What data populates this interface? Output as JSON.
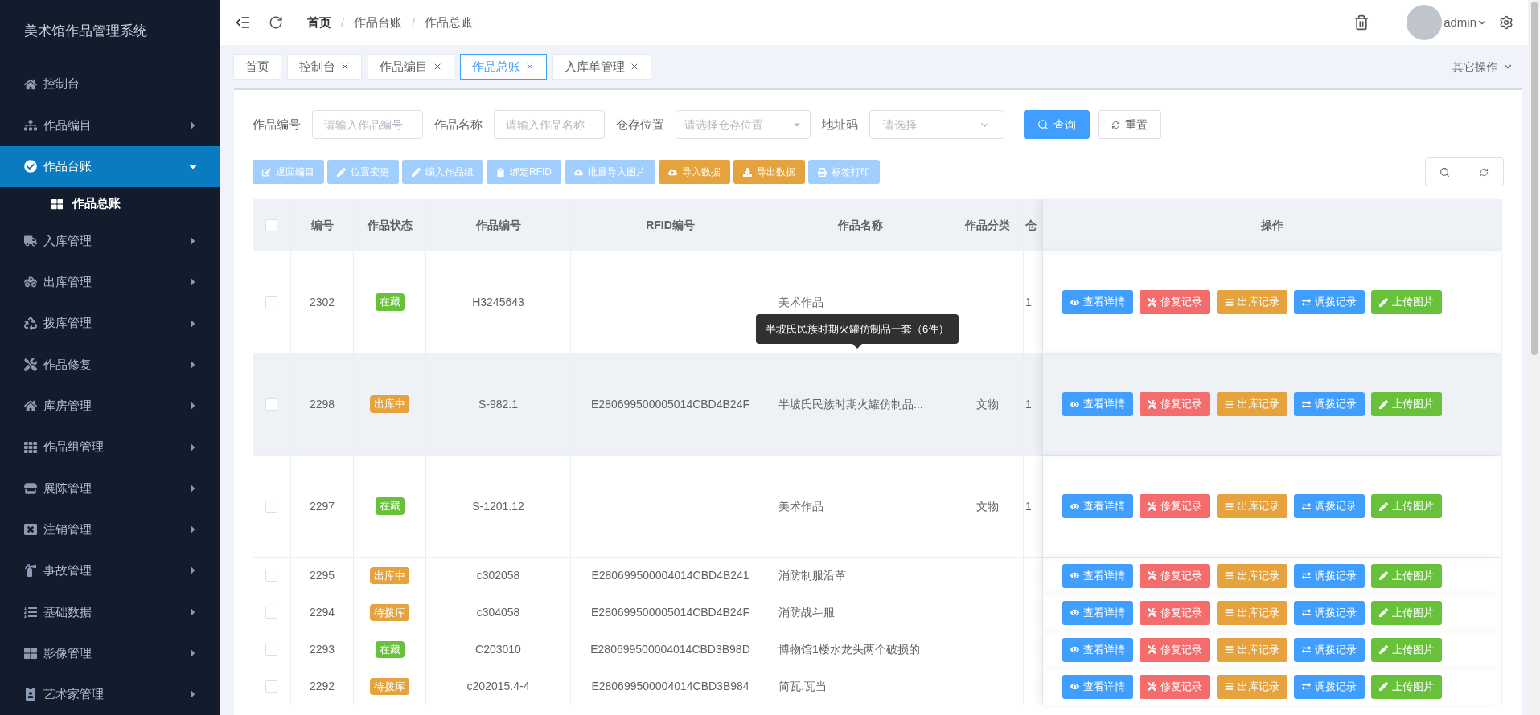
{
  "sidebar": {
    "title": "美术馆作品管理系统",
    "items": [
      {
        "label": "控制台",
        "selected": false,
        "kind": "link"
      },
      {
        "label": "作品编目",
        "selected": false,
        "kind": "submenu",
        "expanded": false
      },
      {
        "label": "作品台账",
        "selected": true,
        "kind": "submenu",
        "expanded": true,
        "children": [
          {
            "label": "作品总账",
            "selected": true
          }
        ]
      },
      {
        "label": "入库管理",
        "selected": false,
        "kind": "submenu",
        "expanded": false
      },
      {
        "label": "出库管理",
        "selected": false,
        "kind": "submenu",
        "expanded": false
      },
      {
        "label": "拨库管理",
        "selected": false,
        "kind": "submenu",
        "expanded": false
      },
      {
        "label": "作品修复",
        "selected": false,
        "kind": "submenu",
        "expanded": false
      },
      {
        "label": "库房管理",
        "selected": false,
        "kind": "submenu",
        "expanded": false
      },
      {
        "label": "作品组管理",
        "selected": false,
        "kind": "submenu",
        "expanded": false
      },
      {
        "label": "展陈管理",
        "selected": false,
        "kind": "submenu",
        "expanded": false
      },
      {
        "label": "注销管理",
        "selected": false,
        "kind": "submenu",
        "expanded": false
      },
      {
        "label": "事故管理",
        "selected": false,
        "kind": "submenu",
        "expanded": false
      },
      {
        "label": "基础数据",
        "selected": false,
        "kind": "submenu",
        "expanded": false
      },
      {
        "label": "影像管理",
        "selected": false,
        "kind": "submenu",
        "expanded": false
      },
      {
        "label": "艺术家管理",
        "selected": false,
        "kind": "submenu",
        "expanded": false
      }
    ]
  },
  "header": {
    "breadcrumb": [
      {
        "label": "首页"
      },
      {
        "separator": "/",
        "label": "作品台账"
      },
      {
        "separator": "/",
        "label": "作品总账"
      }
    ],
    "user": "admin"
  },
  "tabs": [
    {
      "label": "首页",
      "selected": false,
      "closable": false
    },
    {
      "label": "控制台",
      "selected": false,
      "closable": true
    },
    {
      "label": "作品编目",
      "selected": false,
      "closable": true
    },
    {
      "label": "作品总账",
      "selected": true,
      "closable": true
    },
    {
      "label": "入库单管理",
      "selected": false,
      "closable": true
    }
  ],
  "other_actions": "其它操作",
  "filters": [
    {
      "label": "作品编号",
      "kind": "input",
      "placeholder": "请输入作品编号"
    },
    {
      "label": "作品名称",
      "kind": "input",
      "placeholder": "请输入作品名称"
    },
    {
      "label": "仓存位置",
      "kind": "select",
      "placeholder": "请选择仓存位置"
    },
    {
      "label": "地址码",
      "kind": "picker",
      "placeholder": "请选择"
    }
  ],
  "search_buttons": [
    {
      "label": "查询",
      "kind": "primary"
    },
    {
      "label": "重置",
      "kind": "plain"
    }
  ],
  "toolbar": [
    {
      "label": "退回编目",
      "kind": "primary",
      "disabled": true
    },
    {
      "label": "位置变更",
      "kind": "primary",
      "disabled": true
    },
    {
      "label": "编入作品组",
      "kind": "primary",
      "disabled": true
    },
    {
      "label": "绑定RFID",
      "kind": "primary",
      "disabled": true
    },
    {
      "label": "批量导入图片",
      "kind": "primary",
      "disabled": true
    },
    {
      "label": "导入数据",
      "kind": "warning",
      "disabled": false
    },
    {
      "label": "导出数据",
      "kind": "warning",
      "disabled": false
    },
    {
      "label": "标签打印",
      "kind": "primary",
      "disabled": true
    }
  ],
  "table": {
    "all_checked": false,
    "columns": [
      "编号",
      "作品状态",
      "作品编号",
      "RFID编号",
      "作品名称",
      "作品分类",
      "仓",
      "操作"
    ],
    "rows": [
      {
        "checked": false,
        "hovered": false,
        "tall": true,
        "id": "2302",
        "status": {
          "label": "在藏",
          "color": "#67c23a"
        },
        "code": "H3245643",
        "rfid": "",
        "name": "美术作品",
        "category": "",
        "storage": "1",
        "actions": [
          {
            "label": "查看详情",
            "color": "#409eff"
          },
          {
            "label": "修复记录",
            "color": "#f56c6c"
          },
          {
            "label": "出库记录",
            "color": "#e6a23c"
          },
          {
            "label": "调拨记录",
            "color": "#409eff"
          },
          {
            "label": "上传图片",
            "color": "#67c23a"
          }
        ]
      },
      {
        "checked": false,
        "hovered": true,
        "tall": true,
        "id": "2298",
        "status": {
          "label": "出库中",
          "color": "#e6a23c"
        },
        "code": "S-982.1",
        "rfid": "E280699500005014CBD4B24F",
        "name": "半坡氏民族时期火罐仿制品...",
        "category": "文物",
        "storage": "1",
        "actions": [
          {
            "label": "查看详情",
            "color": "#409eff"
          },
          {
            "label": "修复记录",
            "color": "#f56c6c"
          },
          {
            "label": "出库记录",
            "color": "#e6a23c"
          },
          {
            "label": "调拨记录",
            "color": "#409eff"
          },
          {
            "label": "上传图片",
            "color": "#67c23a"
          }
        ]
      },
      {
        "checked": false,
        "hovered": false,
        "tall": true,
        "id": "2297",
        "status": {
          "label": "在藏",
          "color": "#67c23a"
        },
        "code": "S-1201.12",
        "rfid": "",
        "name": "美术作品",
        "category": "文物",
        "storage": "1",
        "actions": [
          {
            "label": "查看详情",
            "color": "#409eff"
          },
          {
            "label": "修复记录",
            "color": "#f56c6c"
          },
          {
            "label": "出库记录",
            "color": "#e6a23c"
          },
          {
            "label": "调拨记录",
            "color": "#409eff"
          },
          {
            "label": "上传图片",
            "color": "#67c23a"
          }
        ]
      },
      {
        "checked": false,
        "hovered": false,
        "tall": false,
        "id": "2295",
        "status": {
          "label": "出库中",
          "color": "#e6a23c"
        },
        "code": "c302058",
        "rfid": "E280699500004014CBD4B241",
        "name": "消防制服沿革",
        "category": "",
        "storage": "",
        "actions": [
          {
            "label": "查看详情",
            "color": "#409eff"
          },
          {
            "label": "修复记录",
            "color": "#f56c6c"
          },
          {
            "label": "出库记录",
            "color": "#e6a23c"
          },
          {
            "label": "调拨记录",
            "color": "#409eff"
          },
          {
            "label": "上传图片",
            "color": "#67c23a"
          }
        ]
      },
      {
        "checked": false,
        "hovered": false,
        "tall": false,
        "id": "2294",
        "status": {
          "label": "待拨库",
          "color": "#e6a23c"
        },
        "code": "c304058",
        "rfid": "E280699500005014CBD4B24F",
        "name": "消防战斗服",
        "category": "",
        "storage": "",
        "actions": [
          {
            "label": "查看详情",
            "color": "#409eff"
          },
          {
            "label": "修复记录",
            "color": "#f56c6c"
          },
          {
            "label": "出库记录",
            "color": "#e6a23c"
          },
          {
            "label": "调拨记录",
            "color": "#409eff"
          },
          {
            "label": "上传图片",
            "color": "#67c23a"
          }
        ]
      },
      {
        "checked": false,
        "hovered": false,
        "tall": false,
        "id": "2293",
        "status": {
          "label": "在藏",
          "color": "#67c23a"
        },
        "code": "C203010",
        "rfid": "E280699500004014CBD3B98D",
        "name": "博物馆1楼水龙头两个破损的",
        "category": "",
        "storage": "",
        "actions": [
          {
            "label": "查看详情",
            "color": "#409eff"
          },
          {
            "label": "修复记录",
            "color": "#f56c6c"
          },
          {
            "label": "出库记录",
            "color": "#e6a23c"
          },
          {
            "label": "调拨记录",
            "color": "#409eff"
          },
          {
            "label": "上传图片",
            "color": "#67c23a"
          }
        ]
      },
      {
        "checked": false,
        "hovered": false,
        "tall": false,
        "id": "2292",
        "status": {
          "label": "待拨库",
          "color": "#e6a23c"
        },
        "code": "c202015.4-4",
        "rfid": "E280699500004014CBD3B984",
        "name": "简瓦.瓦当",
        "category": "",
        "storage": "",
        "actions": [
          {
            "label": "查看详情",
            "color": "#409eff"
          },
          {
            "label": "修复记录",
            "color": "#f56c6c"
          },
          {
            "label": "出库记录",
            "color": "#e6a23c"
          },
          {
            "label": "调拨记录",
            "color": "#409eff"
          },
          {
            "label": "上传图片",
            "color": "#67c23a"
          }
        ]
      }
    ],
    "tooltip": "半坡氏民族时期火罐仿制品一套（6件）"
  }
}
